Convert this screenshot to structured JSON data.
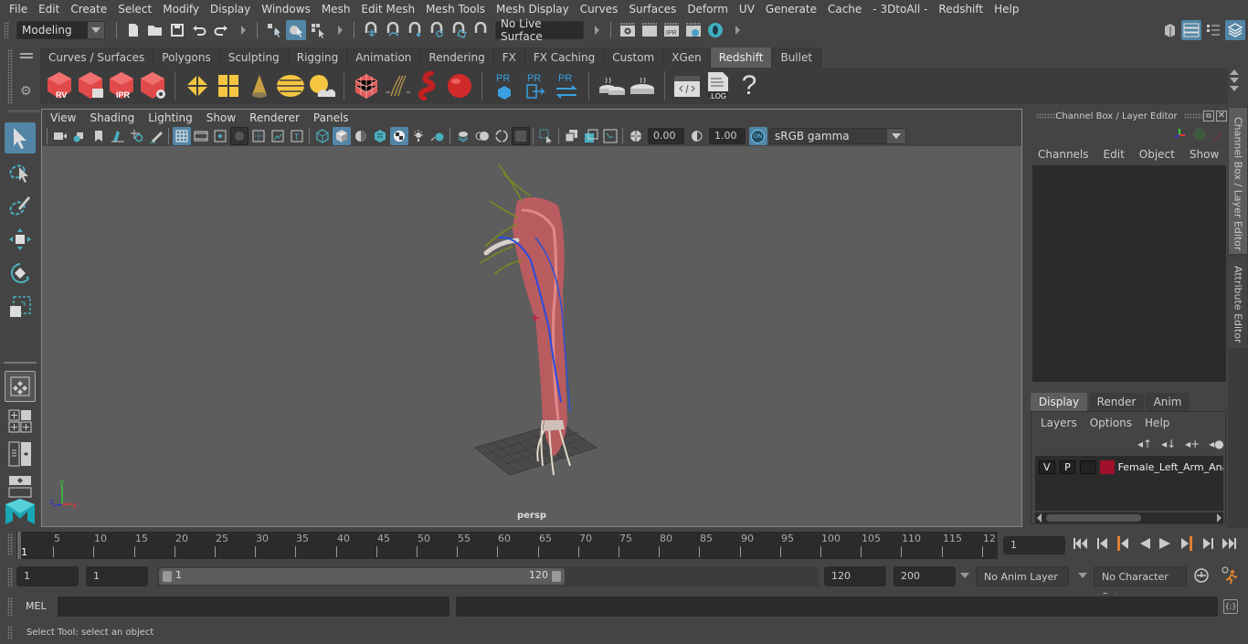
{
  "menubar": {
    "items": [
      "File",
      "Edit",
      "Create",
      "Select",
      "Modify",
      "Display",
      "Windows",
      "Mesh",
      "Edit Mesh",
      "Mesh Tools",
      "Mesh Display",
      "Curves",
      "Surfaces",
      "Deform",
      "UV",
      "Generate",
      "Cache",
      "- 3DtoAll -",
      "Redshift",
      "Help"
    ]
  },
  "statusline": {
    "menuset": "Modeling",
    "live_surface": "No Live Surface"
  },
  "shelf": {
    "tabs": [
      "Curves / Surfaces",
      "Polygons",
      "Sculpting",
      "Rigging",
      "Animation",
      "Rendering",
      "FX",
      "FX Caching",
      "Custom",
      "XGen",
      "Redshift",
      "Bullet"
    ],
    "active_tab": "Redshift",
    "icons": {
      "rv": "RV",
      "ipr": "IPR",
      "pr": "PR",
      "log": ".LOG",
      "help": "?"
    }
  },
  "viewport": {
    "menu": [
      "View",
      "Shading",
      "Lighting",
      "Show",
      "Renderer",
      "Panels"
    ],
    "exposure": "0.00",
    "gamma": "1.00",
    "color_mgmt": "ON",
    "color_space": "sRGB gamma",
    "camera_label": "persp",
    "axis": {
      "x": "x",
      "y": "y",
      "z": "z"
    }
  },
  "channelbox": {
    "title": "Channel Box / Layer Editor",
    "menu": [
      "Channels",
      "Edit",
      "Object",
      "Show"
    ],
    "layer_tabs": [
      "Display",
      "Render",
      "Anim"
    ],
    "active_layer_tab": "Display",
    "layer_menu": [
      "Layers",
      "Options",
      "Help"
    ],
    "layers": [
      {
        "v": "V",
        "p": "P",
        "color": "#a0102a",
        "name": "Female_Left_Arm_Anat"
      }
    ]
  },
  "side_tabs": [
    "Channel Box / Layer Editor",
    "Attribute Editor"
  ],
  "timeline": {
    "ticks": [
      "5",
      "10",
      "15",
      "20",
      "25",
      "30",
      "35",
      "40",
      "45",
      "50",
      "55",
      "60",
      "65",
      "70",
      "75",
      "80",
      "85",
      "90",
      "95",
      "100",
      "105",
      "110",
      "115",
      "12"
    ],
    "current_marker": "1",
    "current_frame": "1"
  },
  "range": {
    "start_frame": "1",
    "playback_start": "1",
    "slider_start": "1",
    "slider_end": "120",
    "playback_end": "120",
    "end_frame": "200",
    "anim_layer": "No Anim Layer",
    "character_set": "No Character Set"
  },
  "cmdline": {
    "label": "MEL"
  },
  "helpline": {
    "text": "Select Tool: select an object"
  }
}
